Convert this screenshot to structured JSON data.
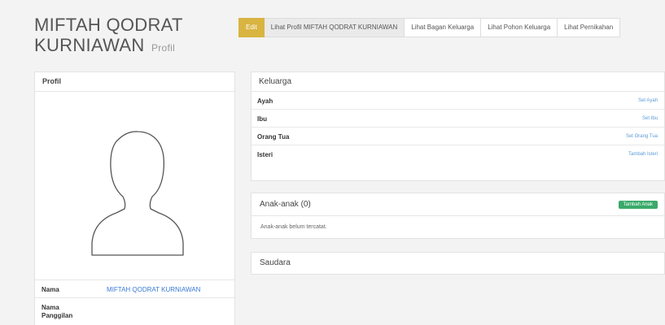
{
  "header": {
    "name_line1": "MIFTAH QODRAT",
    "name_line2": "KURNIAWAN",
    "subtitle": "Profil"
  },
  "tabs": [
    {
      "label": "Edit"
    },
    {
      "label": "Lihat Profil MIFTAH QODRAT KURNIAWAN"
    },
    {
      "label": "Lihat Bagan Keluarga"
    },
    {
      "label": "Lihat Pohon Keluarga"
    },
    {
      "label": "Lihat Pernikahan"
    }
  ],
  "profile": {
    "title": "Profil",
    "fields": [
      {
        "label": "Nama",
        "value": "MIFTAH QODRAT KURNIAWAN"
      },
      {
        "label": "Nama Panggilan",
        "value": ""
      }
    ]
  },
  "keluarga": {
    "title": "Keluarga",
    "rows": [
      {
        "label": "Ayah",
        "action": "Set Ayah"
      },
      {
        "label": "Ibu",
        "action": "Set Ibu"
      },
      {
        "label": "Orang Tua",
        "action": "Set Orang Tua"
      },
      {
        "label": "Isteri",
        "action": "Tambah Isteri"
      }
    ]
  },
  "anak": {
    "title": "Anak-anak (0)",
    "add_label": "Tambah Anak",
    "empty_text": "Anak-anak belum tercatat."
  },
  "saudara": {
    "title": "Saudara"
  },
  "colors": {
    "edit_tab": "#d9b441",
    "link": "#3a7bd5",
    "add_button": "#3aaa6a"
  }
}
